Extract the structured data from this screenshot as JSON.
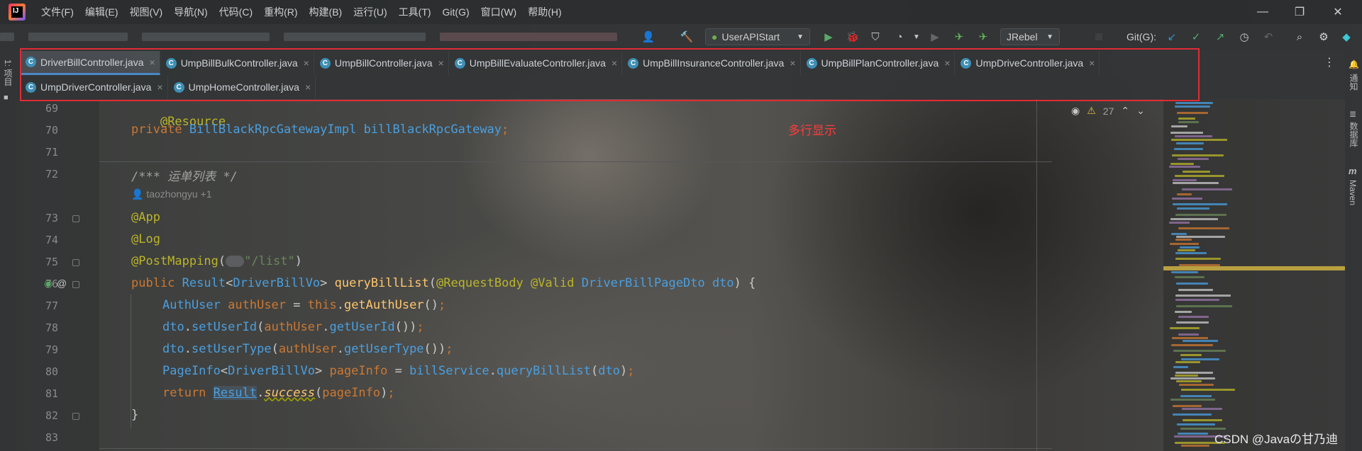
{
  "menubar": {
    "items": [
      "文件(F)",
      "编辑(E)",
      "视图(V)",
      "导航(N)",
      "代码(C)",
      "重构(R)",
      "构建(B)",
      "运行(U)",
      "工具(T)",
      "Git(G)",
      "窗口(W)",
      "帮助(H)"
    ]
  },
  "toolbar": {
    "run_config": "UserAPIStart",
    "jrebel": "JRebel",
    "git_label": "Git(G):"
  },
  "left_stripe": {
    "project_label": "1: 项目"
  },
  "right_stripe": {
    "notifications": "通知",
    "database": "数据库",
    "maven": "Maven"
  },
  "tabs": {
    "row1": [
      {
        "label": "DriverBillController.java",
        "active": true
      },
      {
        "label": "UmpBillBulkController.java",
        "active": false
      },
      {
        "label": "UmpBillController.java",
        "active": false
      },
      {
        "label": "UmpBillEvaluateController.java",
        "active": false
      },
      {
        "label": "UmpBillInsuranceController.java",
        "active": false
      },
      {
        "label": "UmpBillPlanController.java",
        "active": false
      },
      {
        "label": "UmpDriveController.java",
        "active": false
      }
    ],
    "row2": [
      {
        "label": "UmpDriverController.java",
        "active": false
      },
      {
        "label": "UmpHomeController.java",
        "active": false
      }
    ]
  },
  "annotation_note": "多行显示",
  "inspection": {
    "warning_count": "27"
  },
  "editor": {
    "line_numbers": [
      "69",
      "70",
      "71",
      "72",
      "",
      "73",
      "74",
      "75",
      "76",
      "77",
      "78",
      "79",
      "80",
      "81",
      "82",
      "83"
    ],
    "author_hint": "taozhongyu +1",
    "lines": {
      "l69": "@Resource",
      "l70_kw": "private",
      "l70_type": "BillBlackRpcGatewayImpl",
      "l70_field": "billBlackRpcGateway",
      "l72": "/*** 运单列表 */",
      "l73": "@App",
      "l74": "@Log",
      "l75_ann": "@PostMapping",
      "l75_str": "\"/list\"",
      "l76_kw": "public",
      "l76_type": "Result",
      "l76_generic": "DriverBillVo",
      "l76_method": "queryBillList",
      "l76_ann": "@RequestBody @Valid",
      "l76_ptype": "DriverBillPageDto",
      "l76_param": "dto",
      "l77_type": "AuthUser",
      "l77_var": "authUser",
      "l77_this": "this",
      "l77_call": "getAuthUser",
      "l78_obj": "dto",
      "l78_call": "setUserId",
      "l78_arg": "authUser",
      "l78_inner": "getUserId",
      "l79_obj": "dto",
      "l79_call": "setUserType",
      "l79_arg": "authUser",
      "l79_inner": "getUserType",
      "l80_type": "PageInfo",
      "l80_generic": "DriverBillVo",
      "l80_var": "pageInfo",
      "l80_svc": "billService",
      "l80_call": "queryBillList",
      "l80_arg": "dto",
      "l81_kw": "return",
      "l81_cls": "Result",
      "l81_call": "success",
      "l81_arg": "pageInfo",
      "l82": "}"
    }
  },
  "watermark": "CSDN @Javaの甘乃迪",
  "colors": {
    "highlight_box": "#e02b35",
    "annotation_note": "#ff3b3b",
    "keyword": "#cc7832",
    "annotation": "#bbb529",
    "string": "#6a8759",
    "type": "#4a9fe0"
  }
}
